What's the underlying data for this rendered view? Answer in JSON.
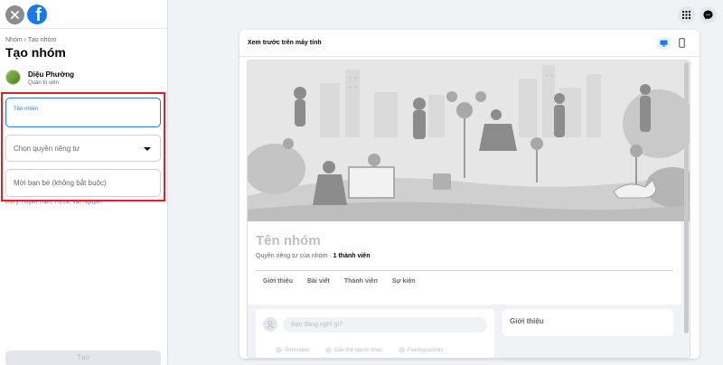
{
  "left_panel": {
    "breadcrumb": "Nhóm › Tạo nhóm",
    "title": "Tạo nhóm",
    "user": {
      "name": "Diệu Phường",
      "role": "Quản trị viên"
    },
    "form": {
      "group_name_label": "Tên nhóm",
      "privacy_placeholder": "Chọn quyền riêng tư",
      "invite_placeholder": "Mời bạn bè (không bắt buộc)"
    },
    "suggestions_prefix": "Gợi ý:",
    "suggestions_names": "Huyền Trâm, Thị Lê, Văn Nguyễn",
    "create_button": "Tạo"
  },
  "preview": {
    "title": "Xem trước trên máy tính",
    "group_name": "Tên nhóm",
    "privacy_text": "Quyền riêng tư của nhóm · ",
    "member_count": "1 thành viên",
    "tabs": [
      "Giới thiệu",
      "Bài viết",
      "Thành viên",
      "Sự kiện"
    ],
    "composer_placeholder": "Bạn đang nghĩ gì?",
    "composer_actions": [
      "Ảnh/video",
      "Gắn thẻ người khác",
      "Feeling/activity"
    ],
    "about_title": "Giới thiệu"
  },
  "icons": {
    "close": "close-icon",
    "logo": "facebook-logo",
    "menu": "grid-menu-icon",
    "messenger": "messenger-icon",
    "desktop": "desktop-icon",
    "mobile": "mobile-icon",
    "caret": "caret-down-icon"
  },
  "colors": {
    "brand": "#1877f2",
    "highlight": "#e41e26",
    "background": "#f0f2f5"
  }
}
